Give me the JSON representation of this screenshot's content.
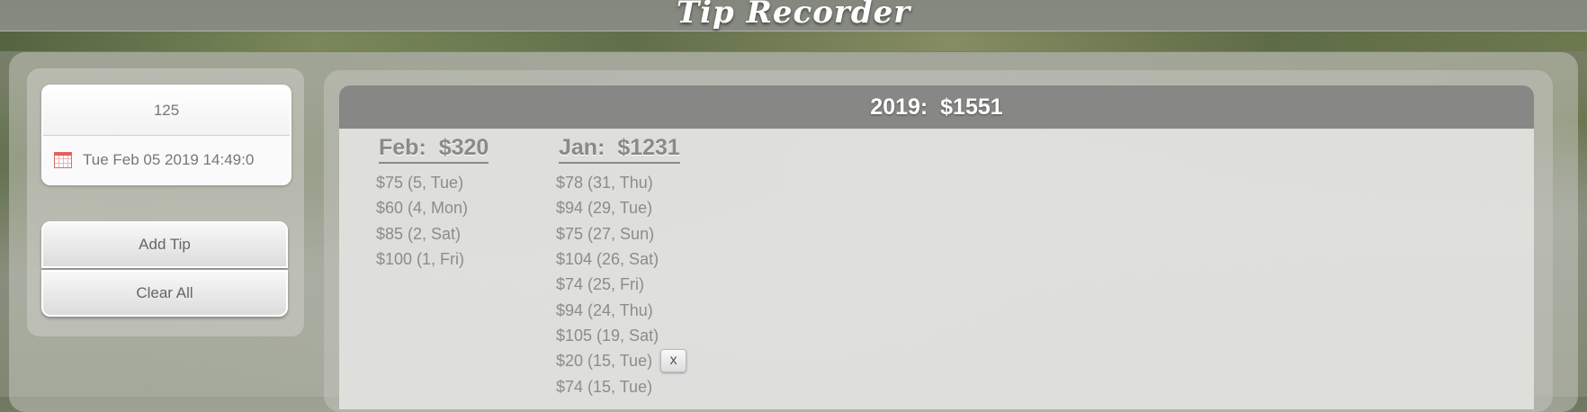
{
  "app": {
    "title": "Tip Recorder"
  },
  "form": {
    "tip_value": "125",
    "date_value": "Tue Feb 05 2019 14:49:0",
    "add_label": "Add Tip",
    "clear_label": "Clear All"
  },
  "year": {
    "label": "2019:",
    "total": "$1551"
  },
  "months": [
    {
      "label": "Feb:",
      "total": "$320",
      "tips": [
        "$75 (5, Tue)",
        "$60 (4, Mon)",
        "$85 (2, Sat)",
        "$100 (1, Fri)"
      ]
    },
    {
      "label": "Jan:",
      "total": "$1231",
      "tips": [
        "$78 (31, Thu)",
        "$94 (29, Tue)",
        "$75 (27, Sun)",
        "$104 (26, Sat)",
        "$74 (25, Fri)",
        "$94 (24, Thu)",
        "$105 (19, Sat)",
        "$20 (15, Tue)",
        "$74 (15, Tue)"
      ]
    }
  ],
  "delete_label": "x",
  "icons": {
    "date": "calendar-icon"
  }
}
